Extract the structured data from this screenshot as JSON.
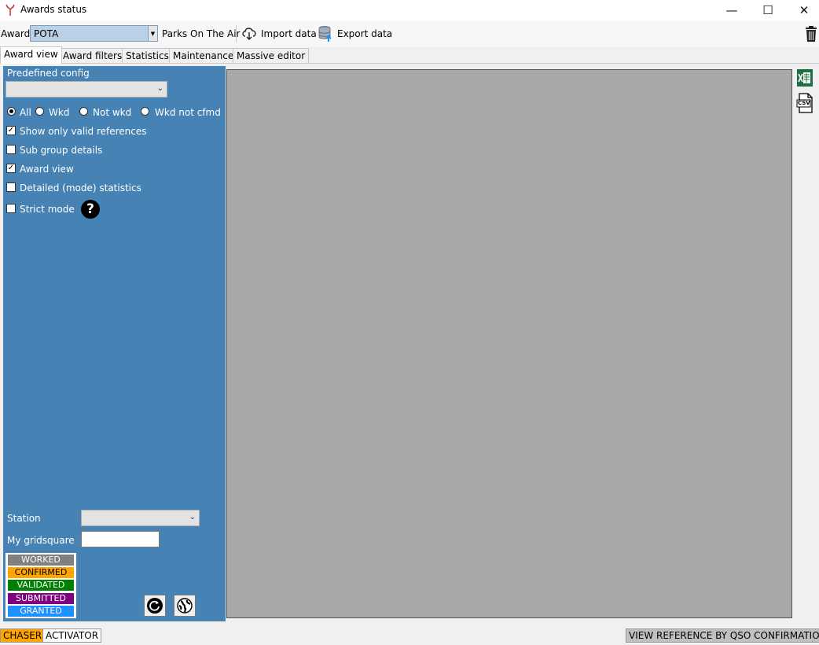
{
  "window": {
    "title": "Awards status",
    "minimize": "—",
    "maximize": "☐",
    "close": "✕"
  },
  "toolbar": {
    "award_label": "Award",
    "award_value": "POTA",
    "award_name": "Parks On The Air",
    "import_label": "Import data",
    "export_label": "Export data"
  },
  "tabs": [
    "Award view",
    "Award filters",
    "Statistics",
    "Maintenance",
    "Massive editor"
  ],
  "panel": {
    "predefined_label": "Predefined config",
    "predefined_value": "",
    "filter": {
      "options": [
        "All",
        "Wkd",
        "Not wkd",
        "Wkd not cfmd"
      ],
      "selected": "All"
    },
    "checkboxes": [
      {
        "label": "Show only valid references",
        "checked": true
      },
      {
        "label": "Sub group details",
        "checked": false
      },
      {
        "label": "Award view",
        "checked": true
      },
      {
        "label": "Detailed (mode) statistics",
        "checked": false
      },
      {
        "label": "Strict mode",
        "checked": false
      }
    ],
    "help_glyph": "?",
    "station_label": "Station",
    "station_value": "",
    "gridsquare_label": "My gridsquare",
    "gridsquare_value": ""
  },
  "legend": [
    {
      "label": "WORKED",
      "color": "#808080"
    },
    {
      "label": "CONFIRMED",
      "color": "#ffa500"
    },
    {
      "label": "VALIDATED",
      "color": "#008000"
    },
    {
      "label": "SUBMITTED",
      "color": "#800080"
    },
    {
      "label": "GRANTED",
      "color": "#1e90ff"
    }
  ],
  "right_icons": [
    "excel-icon",
    "csv-icon"
  ],
  "csv_label": "CSV",
  "status": {
    "chaser": "CHASER",
    "activator": "ACTIVATOR",
    "view_reference": "VIEW REFERENCE BY QSO CONFIRMATION"
  },
  "colors": {
    "panel": "#4682b4",
    "grid": "#a9a9a9",
    "chaser": "#ffa500",
    "excel": "#1d6f42"
  }
}
